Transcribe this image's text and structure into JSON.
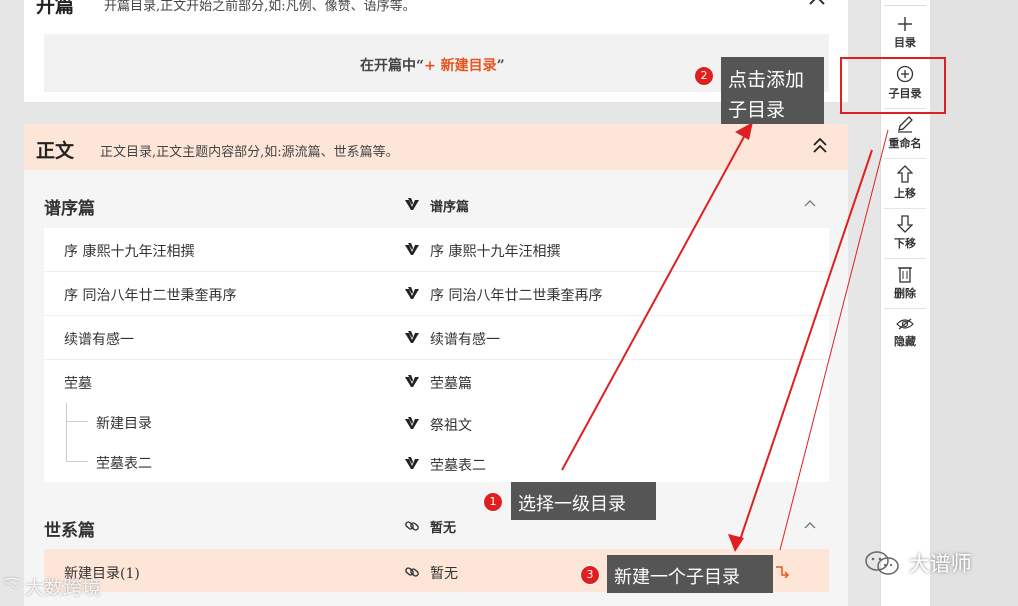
{
  "intro_section": {
    "title": "开篇",
    "desc": "开篇目录,正文开始之前部分,如:凡例、像赞、语序等。",
    "empty_prefix": "在开篇中“",
    "empty_link": "+ 新建目录",
    "empty_suffix": "”"
  },
  "main_section": {
    "title": "正文",
    "desc": "正文目录,正文主题内容部分,如:源流篇、世系篇等。"
  },
  "groups": {
    "pu_xu": {
      "title": "谱序篇",
      "link": "谱序篇",
      "rows": [
        {
          "name": "序 康熙十九年汪相撰",
          "target": "序 康熙十九年汪相撰"
        },
        {
          "name": "序 同治八年廿二世秉奎再序",
          "target": "序 同治八年廿二世秉奎再序"
        },
        {
          "name": "续谱有感一",
          "target": "续谱有感一"
        },
        {
          "name": "茔墓",
          "target": "茔墓篇"
        },
        {
          "name": "新建目录",
          "target": "祭祖文"
        },
        {
          "name": "茔墓表二",
          "target": "茔墓表二"
        }
      ]
    },
    "shi_xi": {
      "title": "世系篇",
      "link": "暂无",
      "rows": [
        {
          "name": "新建目录(1)",
          "target": "暂无"
        }
      ]
    }
  },
  "toolbar": {
    "directory": "目录",
    "sub_directory": "子目录",
    "rename": "重命名",
    "move_up": "上移",
    "move_down": "下移",
    "delete": "删除",
    "hide": "隐藏"
  },
  "callouts": {
    "c1": {
      "num": "1",
      "text": "选择一级目录"
    },
    "c2": {
      "num": "2",
      "line1": "点击添加",
      "line2": "子目录"
    },
    "c3": {
      "num": "3",
      "text": "新建一个子目录"
    }
  },
  "watermarks": {
    "left": "大数跨境",
    "right": "大谱师"
  },
  "colors": {
    "accent": "#e8541e",
    "highlight_bg": "#fde6d8",
    "annotation_red": "#e02020",
    "callout_bg": "#555555"
  }
}
